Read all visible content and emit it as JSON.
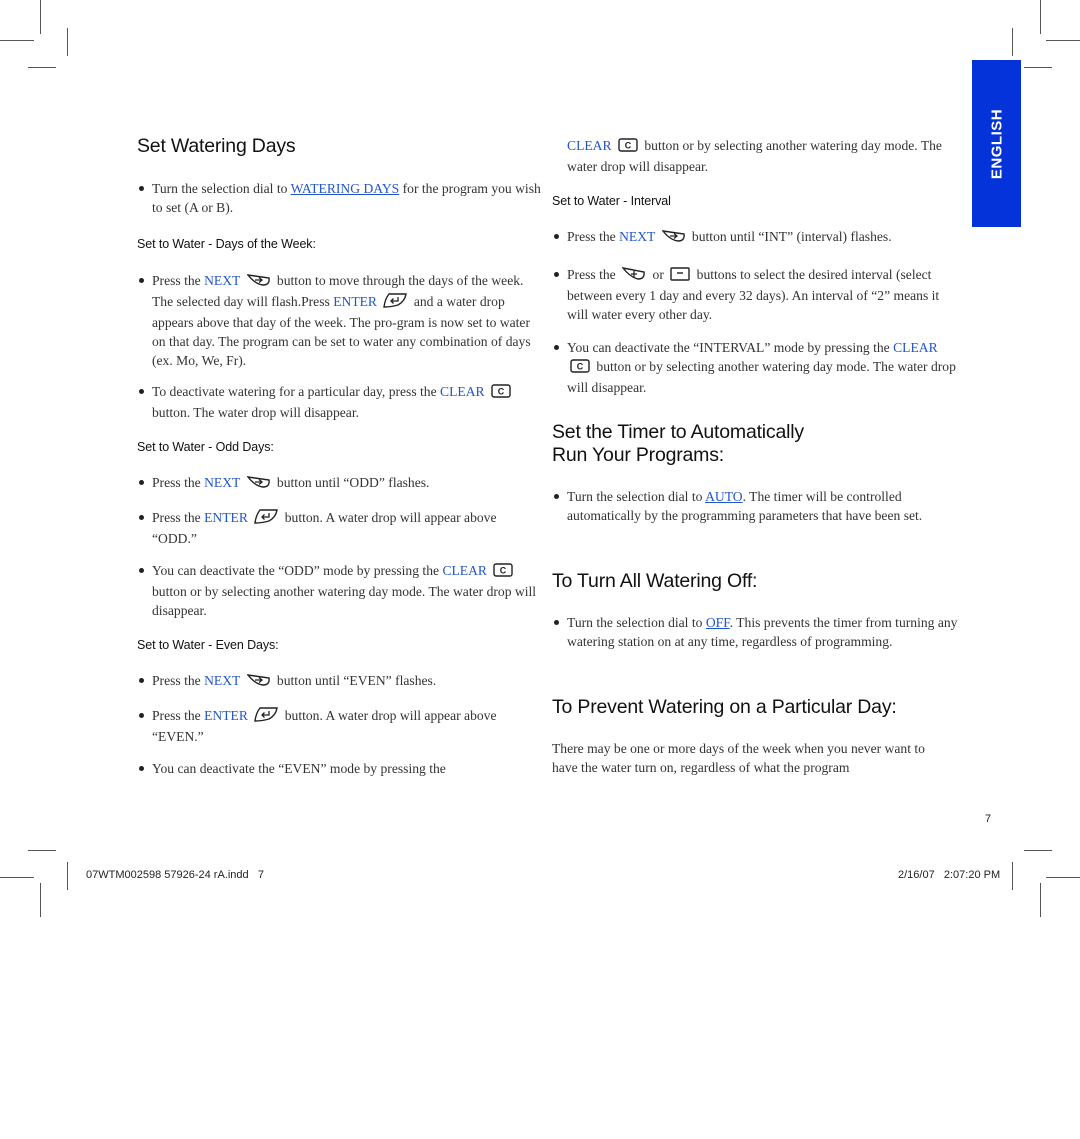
{
  "language_tab": "ENGLISH",
  "page_number": "7",
  "footer": {
    "file": "07WTM002598 57926-24 rA.indd   7",
    "timestamp": "2/16/07   2:07:20 PM"
  },
  "left": {
    "title": "Set Watering Days",
    "intro": {
      "pre": "Turn the selection dial to ",
      "link": "WATERING DAYS",
      "post": " for the program you wish to set (A or B)."
    },
    "week": {
      "heading": "Set to Water - Days of the Week:",
      "b1": {
        "pre": "Press the ",
        "kw1": "NEXT",
        "mid": " button to move through the days of the week. The selected day will flash.Press ",
        "kw2": "ENTER",
        "post": " and a water drop appears above that day of the week. The pro-gram is now set to water on that day. The program can be set to water any combination of days (ex. Mo, We, Fr)."
      },
      "b2": {
        "pre": "To deactivate watering for a particular day, press the ",
        "kw": "CLEAR",
        "post": " button. The water drop will disappear."
      }
    },
    "odd": {
      "heading": "Set to Water - Odd Days:",
      "b1": {
        "pre": "Press the ",
        "kw": "NEXT",
        "post": " button until “ODD” flashes."
      },
      "b2": {
        "pre": "Press the ",
        "kw": "ENTER",
        "post": " button. A water drop will appear above “ODD.”"
      },
      "b3": {
        "pre": "You can deactivate the “ODD” mode by pressing the ",
        "kw": "CLEAR",
        "post": " button or by selecting another watering day mode. The water drop will disappear."
      }
    },
    "even": {
      "heading": "Set to Water - Even Days:",
      "b1": {
        "pre": "Press the ",
        "kw": "NEXT",
        "post": " button until “EVEN” flashes."
      },
      "b2": {
        "pre": "Press the ",
        "kw": "ENTER",
        "post": " button. A water drop will appear above “EVEN.”"
      },
      "b3": {
        "pre": "You can deactivate the “EVEN” mode by pressing the"
      }
    }
  },
  "right": {
    "cont": {
      "kw": "CLEAR",
      "post": " button or by selecting another watering day mode. The water drop will disappear."
    },
    "interval": {
      "heading": "Set to Water - Interval",
      "b1": {
        "pre": "Press the ",
        "kw": "NEXT",
        "post": " button until “INT” (interval) flashes."
      },
      "b2": {
        "pre": "Press the ",
        "mid": " or ",
        "post": " buttons to select the desired interval (select between every 1 day and every 32 days). An interval of “2” means it will water every other day."
      },
      "b3": {
        "pre": "You can deactivate the “INTERVAL” mode by pressing the ",
        "kw": "CLEAR",
        "post": " button or by selecting another watering day mode. The water drop will disappear."
      }
    },
    "auto": {
      "title_line1": "Set the Timer to Automatically",
      "title_line2": "Run Your Programs:",
      "b1": {
        "pre": "Turn the selection dial to ",
        "link": "AUTO",
        "post": ". The timer will be controlled automatically by the programming parameters that have been set."
      }
    },
    "off": {
      "title": "To Turn All Watering Off:",
      "b1": {
        "pre": "Turn the selection dial to ",
        "link": "OFF",
        "post": ". This prevents the timer from turning any watering station on at any time, regardless of programming."
      }
    },
    "prevent": {
      "title": "To Prevent Watering on a Particular Day:",
      "text": "There may be one or more days of the week when you never want to have the water turn on, regardless of what the program"
    }
  }
}
